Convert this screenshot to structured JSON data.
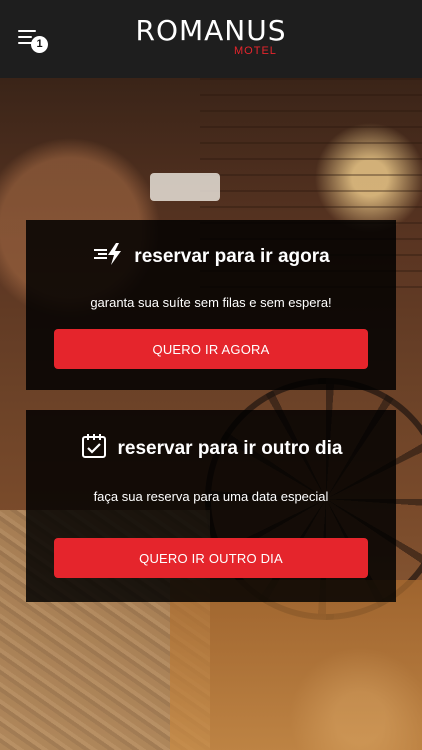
{
  "header": {
    "menu_badge": "1",
    "brand": "ROMANUS",
    "brand_sub": "MOTEL"
  },
  "cards": [
    {
      "icon": "lightning-speed-icon",
      "title": "reservar para ir agora",
      "description": "garanta sua suíte sem filas e sem espera!",
      "button": "QUERO IR AGORA"
    },
    {
      "icon": "calendar-check-icon",
      "title": "reservar para ir outro dia",
      "description": "faça sua reserva para uma data especial",
      "button": "QUERO IR OUTRO DIA"
    }
  ],
  "colors": {
    "accent": "#e5252c",
    "header_bg": "#1e1e1e",
    "card_bg": "rgba(0,0,0,0.84)"
  }
}
